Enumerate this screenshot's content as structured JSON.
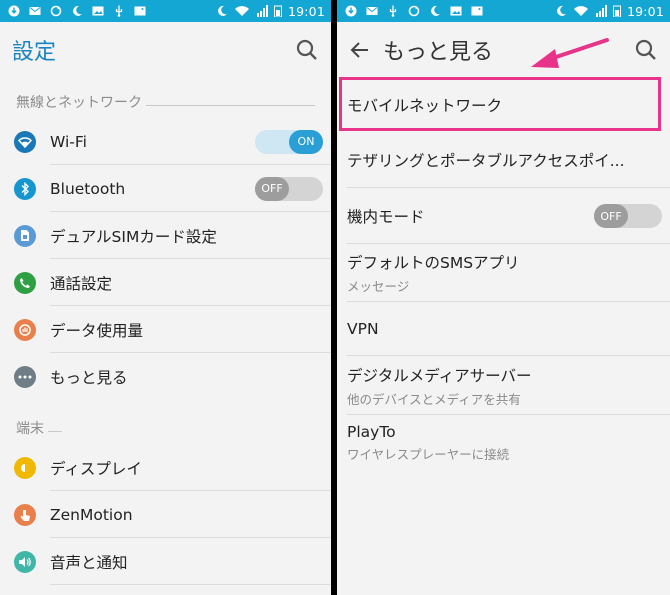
{
  "status": {
    "time": "19:01",
    "colors": {
      "bar": "#15a7d4"
    }
  },
  "left": {
    "title": "設定",
    "section_wireless": "無線とネットワーク",
    "items": [
      {
        "label": "Wi-Fi",
        "icon": "wifi-icon",
        "color": "#1a78b8"
      },
      {
        "label": "Bluetooth",
        "icon": "bluetooth-icon",
        "color": "#1596d0"
      },
      {
        "label": "デュアルSIMカード設定",
        "icon": "sim-card-icon",
        "color": "#5b9bd5"
      },
      {
        "label": "通話設定",
        "icon": "phone-icon",
        "color": "#2ea043"
      },
      {
        "label": "データ使用量",
        "icon": "data-usage-icon",
        "color": "#e9804b"
      },
      {
        "label": "もっと見る",
        "icon": "more-icon",
        "color": "#6f7d86"
      }
    ],
    "wifi_toggle": "ON",
    "bt_toggle": "OFF",
    "section_device": "端末",
    "device_items": [
      {
        "label": "ディスプレイ",
        "icon": "display-icon",
        "color": "#f1b800"
      },
      {
        "label": "ZenMotion",
        "icon": "zenmotion-icon",
        "color": "#e9804b"
      },
      {
        "label": "音声と通知",
        "icon": "sound-icon",
        "color": "#3fb6a8"
      }
    ]
  },
  "right": {
    "title": "もっと見る",
    "items": [
      {
        "label": "モバイルネットワーク"
      },
      {
        "label": "テザリングとポータブルアクセスポイ..."
      },
      {
        "label": "機内モード"
      },
      {
        "label": "デフォルトのSMSアプリ",
        "sub": "メッセージ"
      },
      {
        "label": "VPN"
      },
      {
        "label": "デジタルメディアサーバー",
        "sub": "他のデバイスとメディアを共有"
      },
      {
        "label": "PlayTo",
        "sub": "ワイヤレスプレーヤーに接続"
      }
    ],
    "airplane_toggle": "OFF",
    "accent": "#e8338a"
  }
}
